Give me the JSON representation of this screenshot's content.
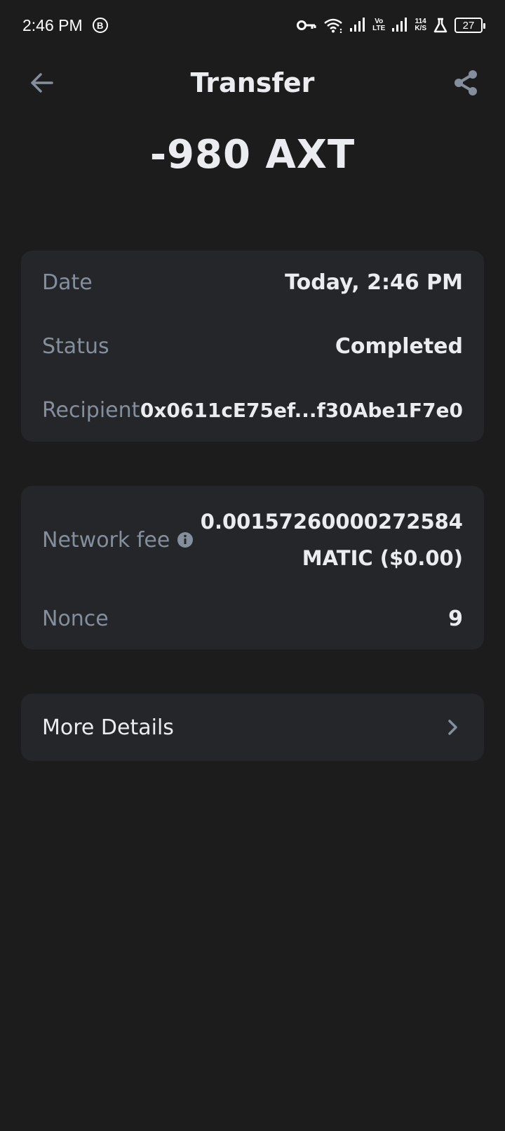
{
  "status_bar": {
    "time": "2:46 PM",
    "b_icon": "B",
    "volte": [
      "Vo",
      "LTE"
    ],
    "speed": [
      "114",
      "K/S"
    ],
    "battery": "27"
  },
  "header": {
    "title": "Transfer"
  },
  "amount": "-980 AXT",
  "details": {
    "date_label": "Date",
    "date_value": "Today, 2:46 PM",
    "status_label": "Status",
    "status_value": "Completed",
    "recipient_label": "Recipient",
    "recipient_value": "0x0611cE75ef...f30Abe1F7e0"
  },
  "fees": {
    "network_fee_label": "Network fee",
    "network_fee_value_line1": "0.00157260000272584",
    "network_fee_value_line2": "MATIC ($0.00)",
    "nonce_label": "Nonce",
    "nonce_value": "9"
  },
  "more_details": {
    "label": "More Details"
  },
  "colors": {
    "background": "#1c1c1c",
    "card": "#252629",
    "label": "#848e9c",
    "text": "#eaecef"
  }
}
